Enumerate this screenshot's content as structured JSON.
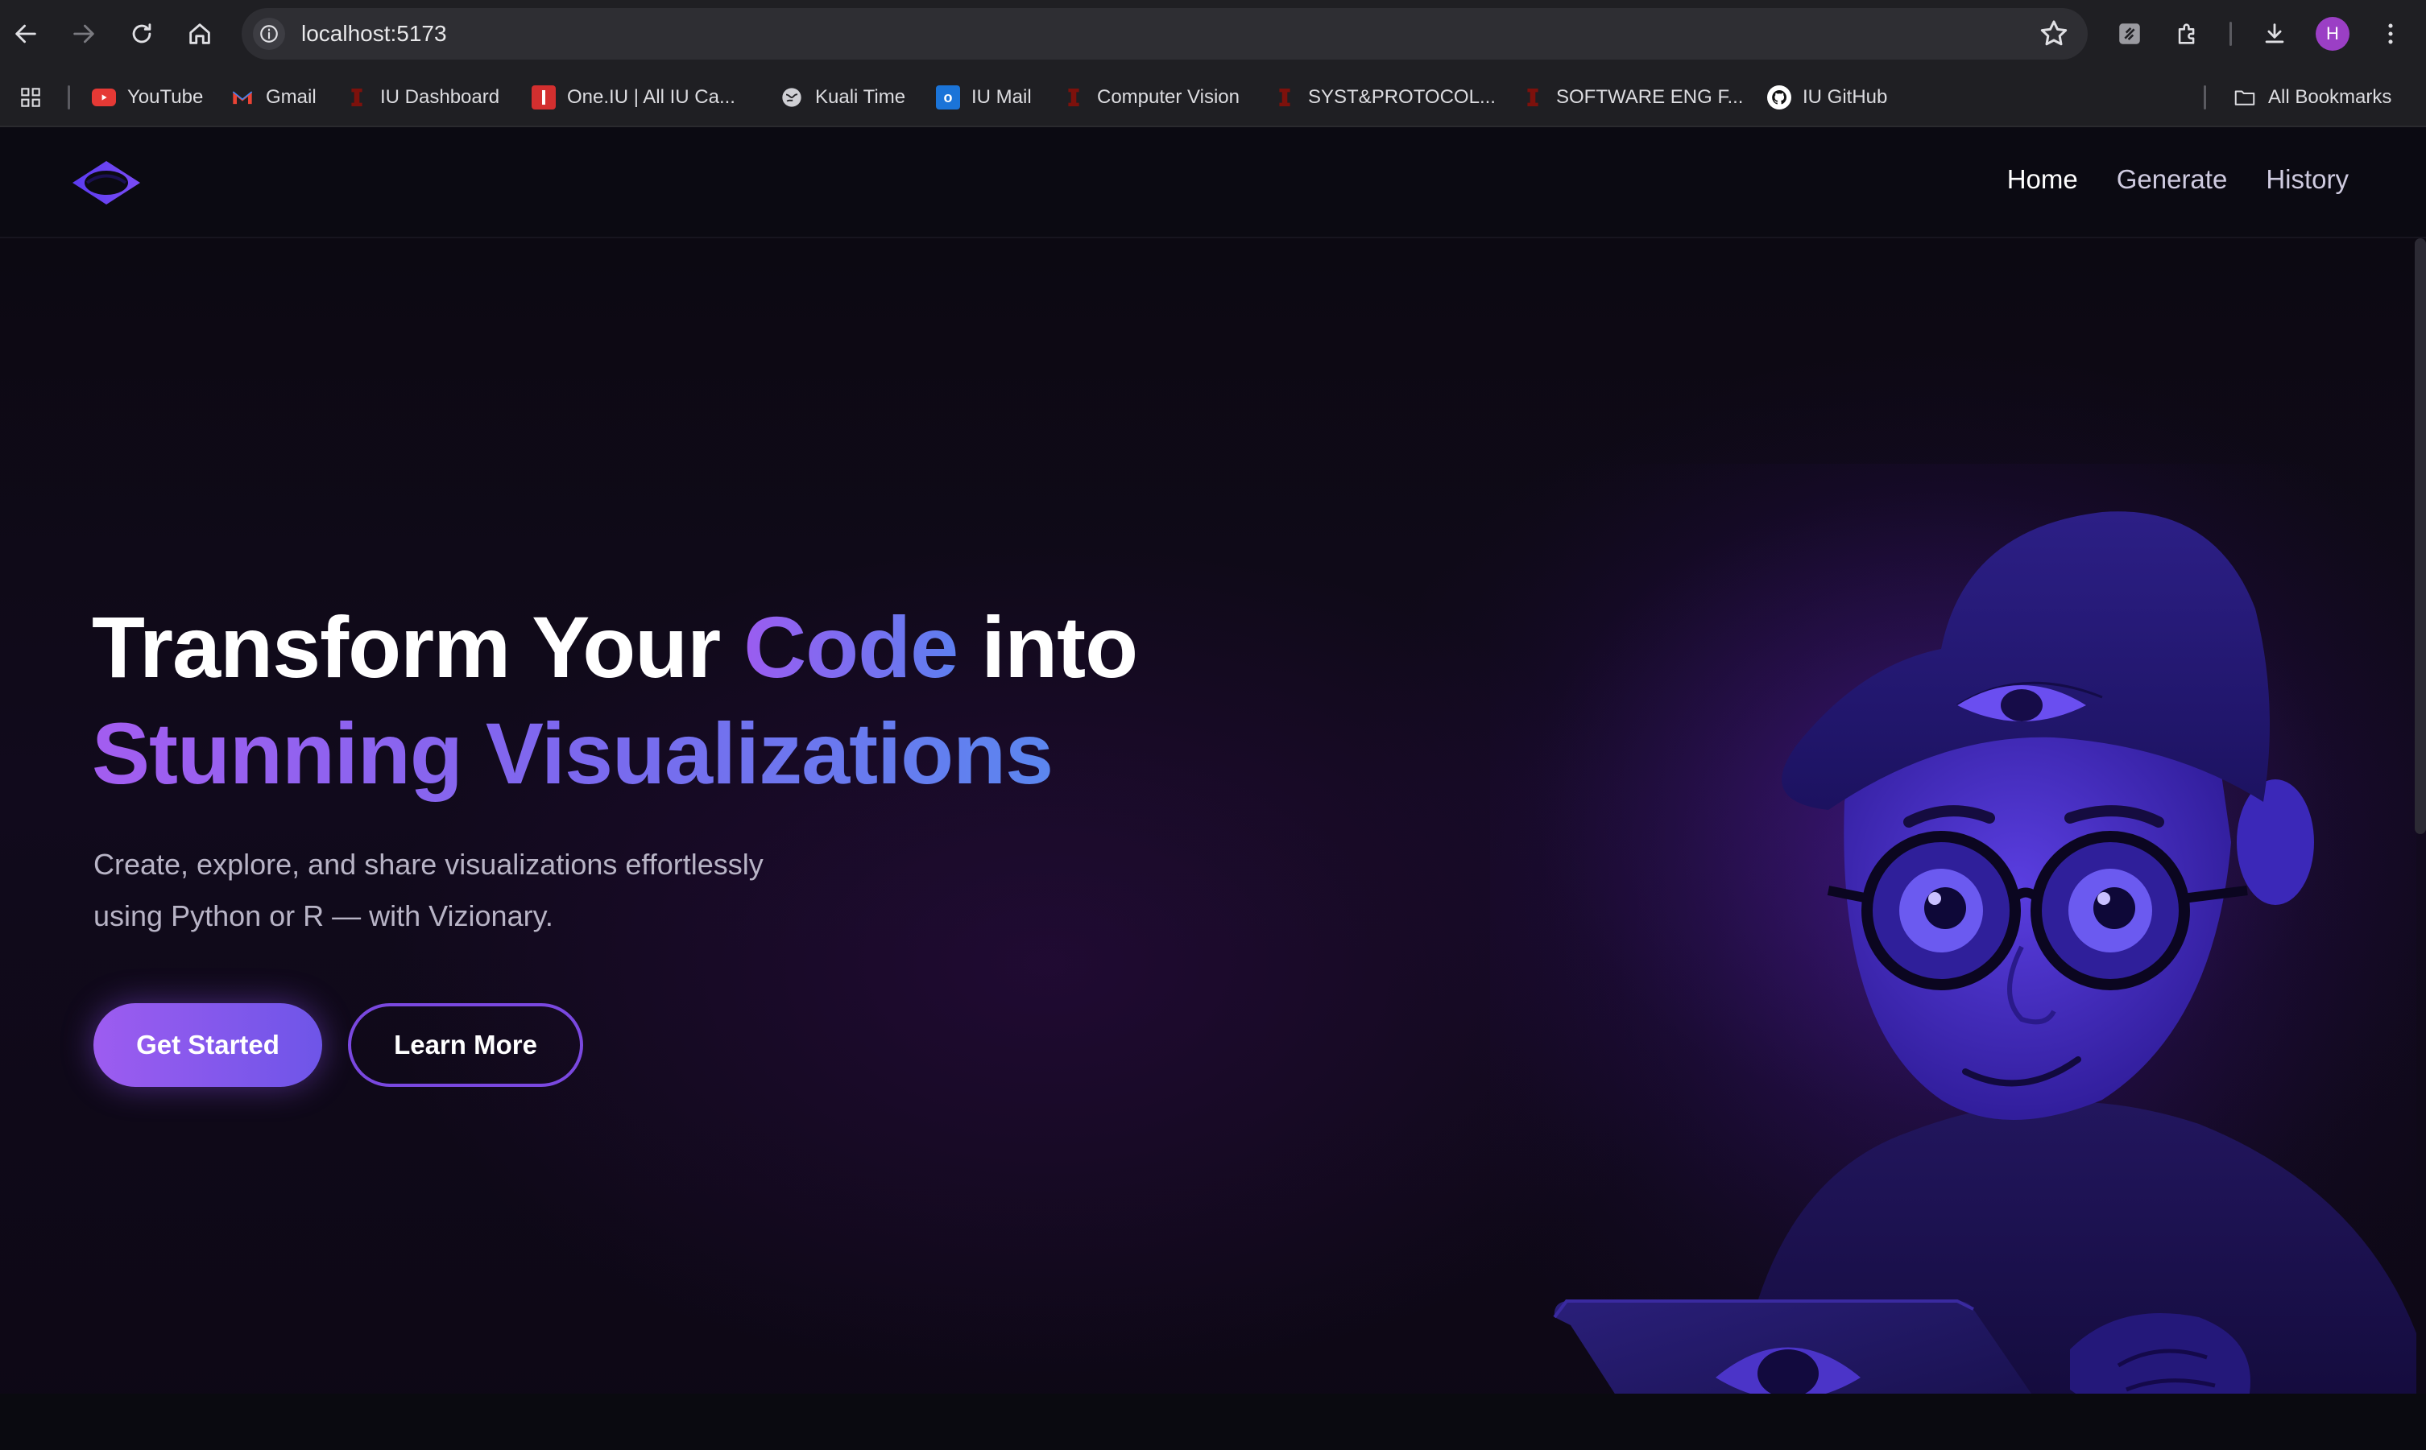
{
  "browser": {
    "url": "localhost:5173",
    "profile_initial": "H",
    "accent": "#9b3fc5"
  },
  "bookmarks": [
    {
      "label": "YouTube",
      "icon": "youtube-icon"
    },
    {
      "label": "Gmail",
      "icon": "gmail-icon"
    },
    {
      "label": "IU Dashboard",
      "icon": "iu-icon"
    },
    {
      "label": "One.IU | All IU Ca...",
      "icon": "oneiu-icon"
    },
    {
      "label": "Kuali Time",
      "icon": "kuali-icon"
    },
    {
      "label": "IU Mail",
      "icon": "outlook-icon"
    },
    {
      "label": "Computer Vision",
      "icon": "iu-icon"
    },
    {
      "label": "SYST&PROTOCOL...",
      "icon": "iu-icon"
    },
    {
      "label": "SOFTWARE ENG F...",
      "icon": "iu-icon"
    },
    {
      "label": "IU GitHub",
      "icon": "github-icon"
    }
  ],
  "all_bookmarks_label": "All Bookmarks",
  "site": {
    "nav": [
      {
        "label": "Home",
        "active": true
      },
      {
        "label": "Generate",
        "active": false
      },
      {
        "label": "History",
        "active": false
      }
    ],
    "hero": {
      "title_part1": "Transform Your ",
      "title_highlight": "Code",
      "title_part2": " into",
      "title_line2": "Stunning Visualizations",
      "subtitle_line1": "Create, explore, and share visualizations effortlessly",
      "subtitle_line2": "using Python or R — with Vizionary.",
      "primary_cta": "Get Started",
      "secondary_cta": "Learn More"
    },
    "colors": {
      "brand_purple": "#9d5cf0",
      "brand_blue": "#5b86ef",
      "background": "#09070e"
    }
  }
}
